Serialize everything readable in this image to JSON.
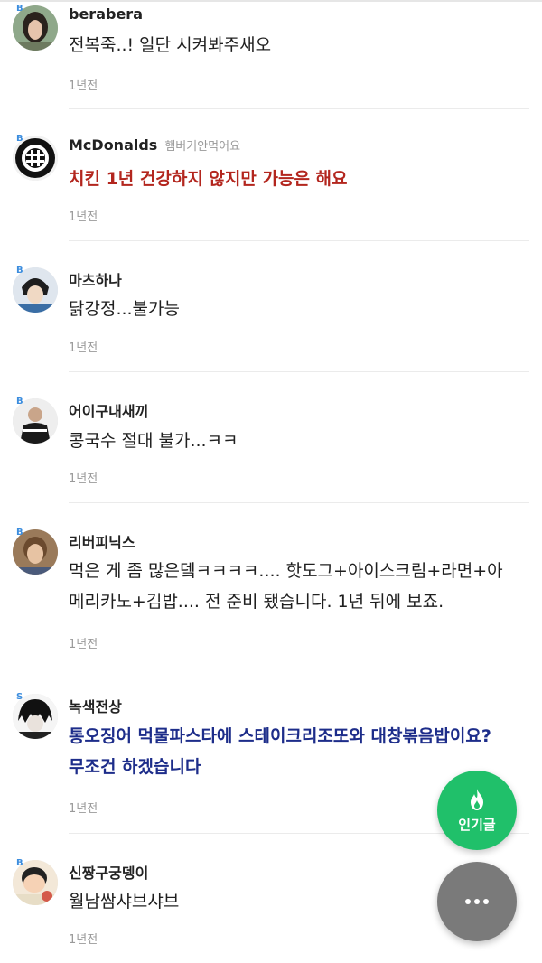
{
  "comments": [
    {
      "username": "berabera",
      "tagline": "",
      "text": "전복죽..! 일단 시켜봐주새오",
      "time": "1년전",
      "level": "B"
    },
    {
      "username": "McDonalds",
      "tagline": "햄버거안먹어요",
      "text": "치킨 1년 건강하지 않지만 가능은 해요",
      "time": "1년전",
      "level": "B"
    },
    {
      "username": "마츠하나",
      "tagline": "",
      "text": "닭강정...불가능",
      "time": "1년전",
      "level": "B"
    },
    {
      "username": "어이구내새끼",
      "tagline": "",
      "text": "콩국수 절대 불가...ㅋㅋ",
      "time": "1년전",
      "level": "B"
    },
    {
      "username": "리버피닉스",
      "tagline": "",
      "text_line1": "먹은 게 좀 많은뎈ㅋㅋㅋㅋ.... 핫도그+아이스크림+라면+아",
      "text_line2": "메리카노+김밥.... 전 준비 됐습니다. 1년 뒤에 보죠.",
      "time": "1년전",
      "level": "B"
    },
    {
      "username": "녹색전상",
      "tagline": "",
      "text_line1": "통오징어 먹물파스타에 스테이크리조또와 대창볶음밥이요?",
      "text_line2": "무조건 하겠습니다",
      "time": "1년전",
      "level": "S"
    },
    {
      "username": "신짱구궁뎅이",
      "tagline": "",
      "text": "월남쌈샤브샤브",
      "time": "1년전",
      "level": "B"
    }
  ],
  "fab": {
    "popular_label": "인기글",
    "popular_icon": "fire-icon",
    "more_icon": "more-dots-icon",
    "popular_color": "#20c06a",
    "more_color": "#7a7a7a"
  },
  "colors": {
    "highlight_red": "#b3261e",
    "highlight_blue": "#1d2d8a",
    "level_badge": "#3c8dde"
  }
}
